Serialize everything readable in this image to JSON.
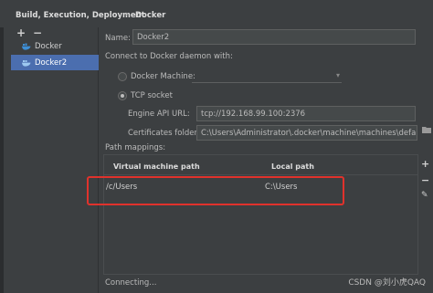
{
  "breadcrumb": {
    "section": "Build, Execution, Deployment",
    "separator": "›",
    "page": "Docker"
  },
  "toolbar": {
    "add_label": "+",
    "remove_label": "−"
  },
  "docker_list": {
    "items": [
      {
        "label": "Docker",
        "selected": false
      },
      {
        "label": "Docker2",
        "selected": true
      }
    ]
  },
  "form": {
    "name_label": "Name:",
    "name_value": "Docker2",
    "connect_label": "Connect to Docker daemon with:",
    "docker_machine_label": "Docker Machine:",
    "docker_machine_checked": false,
    "tcp_socket_label": "TCP socket",
    "tcp_socket_checked": true,
    "engine_api_label": "Engine API URL:",
    "engine_api_value": "tcp://192.168.99.100:2376",
    "certs_label": "Certificates folder:",
    "certs_value": "C:\\Users\\Administrator\\.docker\\machine\\machines\\default"
  },
  "path_mappings": {
    "label": "Path mappings:",
    "columns": [
      "Virtual machine path",
      "Local path"
    ],
    "rows": [
      {
        "vm_path": "/c/Users",
        "local_path": "C:\\Users"
      }
    ],
    "side_buttons": [
      "+",
      "−",
      "✎"
    ]
  },
  "status": {
    "text": "Connecting..."
  },
  "watermark": "CSDN @刘小虎QAQ",
  "colors": {
    "background": "#3c3f41",
    "selection": "#4b6eaf",
    "highlight_border": "#e0322c",
    "docker_icon": "#3d8fd6"
  }
}
